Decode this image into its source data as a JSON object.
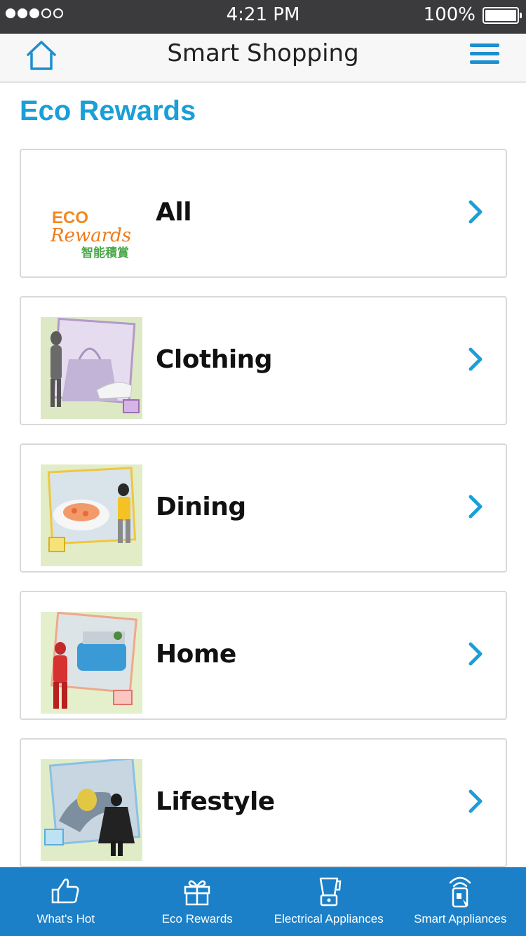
{
  "status_bar": {
    "signal_dots_filled": 3,
    "signal_dots_total": 5,
    "time": "4:21 PM",
    "battery": "100%"
  },
  "nav": {
    "title": "Smart Shopping",
    "home_icon": "home-icon",
    "menu_icon": "hamburger-menu-icon",
    "accent_color": "#1a8fd0"
  },
  "section": {
    "title": "Eco Rewards",
    "title_color": "#1a9fd8"
  },
  "logo": {
    "line1": "ECO",
    "line2": "Rewards",
    "line3": "智能積賞"
  },
  "categories": [
    {
      "label": "All",
      "image": "eco-rewards-logo"
    },
    {
      "label": "Clothing",
      "image": "clothing-photo"
    },
    {
      "label": "Dining",
      "image": "dining-photo"
    },
    {
      "label": "Home",
      "image": "home-photo"
    },
    {
      "label": "Lifestyle",
      "image": "lifestyle-photo"
    }
  ],
  "tabs": [
    {
      "label": "What's Hot",
      "icon": "thumbs-up-icon"
    },
    {
      "label": "Eco Rewards",
      "icon": "gift-icon"
    },
    {
      "label": "Electrical Appliances",
      "icon": "blender-icon"
    },
    {
      "label": "Smart Appliances",
      "icon": "wifi-phone-icon"
    }
  ],
  "tab_bar_color": "#1b80c7"
}
